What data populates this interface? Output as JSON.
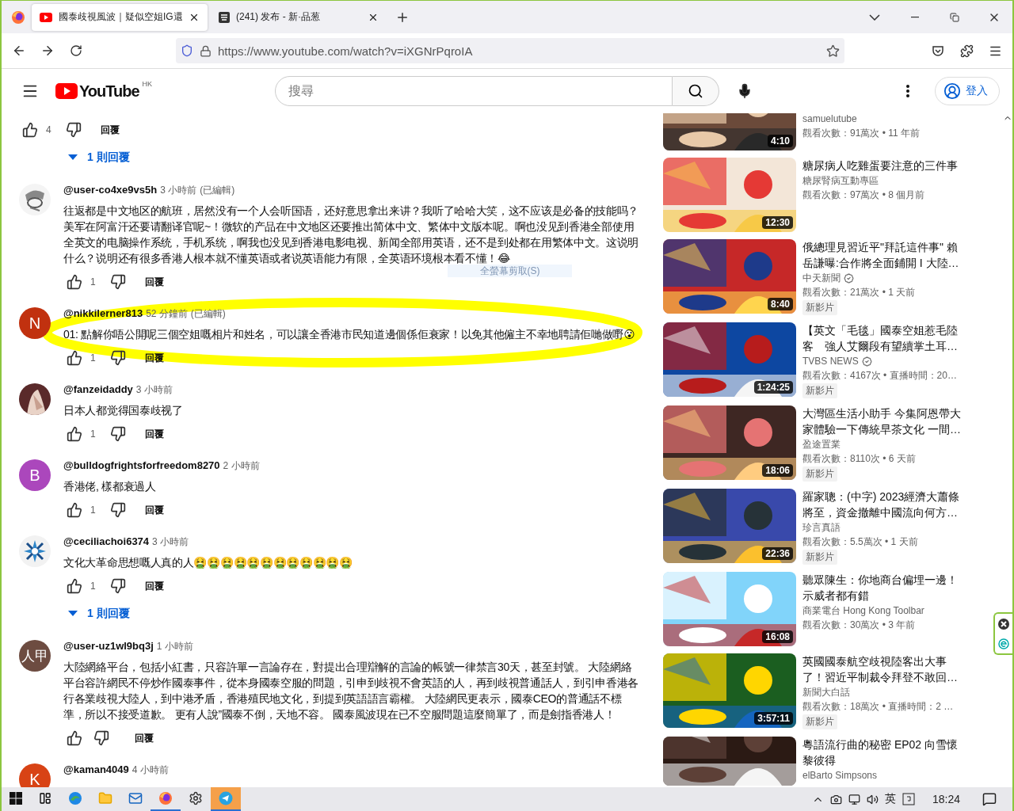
{
  "browser": {
    "tabs": [
      {
        "title": "國泰歧視風波｜疑似空姐IG還",
        "kind": "video",
        "selected": true
      },
      {
        "title": "(241) 发布 - 新·品葱",
        "kind": "forum",
        "selected": false
      }
    ],
    "url": "https://www.youtube.com/watch?v=iXGNrPqroIA"
  },
  "masthead": {
    "logo": "YouTube",
    "region": "HK",
    "search": {
      "placeholder": "搜尋"
    },
    "sign_in": "登入"
  },
  "overlay_hint": "全螢幕剪取(S)",
  "comments_top": {
    "likes": "4",
    "reply": "回覆",
    "replies": "1 則回覆"
  },
  "comments": [
    {
      "kind": "full",
      "avatar": {
        "kind": "sketch"
      },
      "author": "@user-co4xe9vs5h",
      "time": "3 小時前",
      "edited": "(已編輯)",
      "text": "往返都是中文地区的航班，居然没有一个人会听国语，还好意思拿出来讲？我听了哈哈大笑，这不应该是必备的技能吗？美军在阿富汗还要请翻译官呢~！微软的产品在中文地区还要推出简体中文、繁体中文版本呢。啊也没见到香港全部使用全英文的电脑操作系统，手机系统，啊我也没见到香港电影电视、新闻全部用英语，还不是到处都在用繁体中文。这说明什么？说明还有很多香港人根本就不懂英语或者说英语能力有限，全英语环境根本看不懂！😂",
      "likes": "1",
      "reply": "回覆",
      "highlighted": false
    },
    {
      "kind": "full",
      "avatar": {
        "kind": "letter",
        "letter": "N",
        "color": "#c1310f"
      },
      "author": "@nikkilerner813",
      "time": "52 分鐘前",
      "edited": "(已編輯)",
      "text": "01: 點解你唔公開呢三個空姐嘅相片和姓名，可以讓全香港市民知道邊個係佢衰家！以免其他僱主不幸地聘請佢哋做嘢😮",
      "likes": "1",
      "reply": "回覆",
      "highlighted": true
    },
    {
      "kind": "full",
      "author": "@fanzeidaddy",
      "time": "3 小時前",
      "text": "日本人都觉得国泰歧视了",
      "likes": "1",
      "reply": "回覆",
      "highlighted": false
    },
    {
      "kind": "full",
      "avatar": {
        "kind": "letter",
        "letter": "B",
        "color": "#ab47bc"
      },
      "author": "@bulldogfrightsforfreedom8270",
      "time": "2 小時前",
      "text": "香港佬, 樣都衰過人",
      "likes": "1",
      "reply": "回覆",
      "highlighted": false
    },
    {
      "kind": "full",
      "avatar": {
        "kind": "snowflake"
      },
      "author": "@ceciliachoi6374",
      "time": "3 小時前",
      "text": "文化大革命思想嘅人真的人🤮🤮🤮🤮🤮🤮🤮🤮🤮🤮🤮🤮",
      "likes": "1",
      "reply": "回覆",
      "replies": "1 則回覆",
      "highlighted": false
    },
    {
      "kind": "full",
      "avatar": {
        "kind": "letter",
        "letter": "人甲",
        "color": "#6d4c41"
      },
      "author": "@user-uz1wl9bq3j",
      "time": "1 小時前",
      "text": "大陸網絡平台，包括小紅書，只容許單一言論存在，對提出合理辯解的言論的帳號一律禁言30天，甚至封號。 大陸網絡平台容許網民不停炒作國泰事件，從本身國泰空服的問題，引申到歧視不會英語的人，再到歧視普通話人，到引申香港各行各業歧視大陸人，到中港矛盾，香港殖民地文化，到提到英語語言霸權。 大陸網民更表示，國泰CEO的普通話不標準，所以不接受道歉。 更有人說”國泰不倒，天地不容。 國泰風波現在已不空服問題這麼簡單了，而是劍指香港人！",
      "reply": "回覆",
      "highlighted": false
    },
    {
      "kind": "cut",
      "avatar": {
        "kind": "letter",
        "letter": "K",
        "color": "#d84315"
      },
      "author": "@kaman4049",
      "time": "4 小時前",
      "highlighted": false
    }
  ],
  "related": [
    {
      "kind": "cut",
      "channel": "samuelutube",
      "meta": "觀看次數：91萬次 • 11 年前",
      "duration": "4:10",
      "verified": false,
      "new": false
    },
    {
      "kind": "full",
      "title": "糖尿病人吃雞蛋要注意的三件事",
      "channel": "糖尿腎病互動專區",
      "meta": "觀看次數：97萬次 • 8 個月前",
      "duration": "12:30",
      "verified": false,
      "new": false
    },
    {
      "kind": "full",
      "title": "俄總理見習近平\"拜託這件事\" 賴岳謙曝:合作將全面鋪開 I 大陸…",
      "channel": "中天新聞",
      "meta": "觀看次數：21萬次 • 1 天前",
      "duration": "8:40",
      "verified": true,
      "new": true,
      "badge": "新影片"
    },
    {
      "kind": "full",
      "title": "【英文「毛毯」國泰空姐惹毛陸客　強人艾爾段有望續掌土耳…",
      "channel": "TVBS NEWS",
      "meta": "觀看次數：4167次 • 直播時間：20…",
      "duration": "1:24:25",
      "verified": true,
      "new": true,
      "badge": "新影片"
    },
    {
      "kind": "full",
      "title": "大灣區生活小助手 今集阿恩帶大家體驗一下傳統早茶文化 一間…",
      "channel": "盈途置業",
      "meta": "觀看次數：8110次 • 6 天前",
      "duration": "18:06",
      "verified": false,
      "new": true,
      "badge": "新影片"
    },
    {
      "kind": "full",
      "title": "羅家聰：(中字) 2023經濟大蕭條將至，資金撤離中國流向何方…",
      "channel": "珍言真語",
      "meta": "觀看次數：5.5萬次 • 1 天前",
      "duration": "22:36",
      "verified": false,
      "new": true,
      "badge": "新影片"
    },
    {
      "kind": "full",
      "title": "聽眾陳生：你地商台偏埋一邊！示威者都有錯",
      "channel": "商業電台 Hong Kong Toolbar",
      "meta": "觀看次數：30萬次 • 3 年前",
      "duration": "16:08",
      "verified": false,
      "new": false
    },
    {
      "kind": "full",
      "title": "英國國泰航空歧視陸客出大事了！習近平制裁令拜登不敢回…",
      "channel": "新聞大白話",
      "meta": "觀看次數：18萬次 • 直播時間：2 …",
      "duration": "3:57:11",
      "verified": false,
      "new": true,
      "badge": "新影片"
    },
    {
      "kind": "bottom",
      "title": "粵語流行曲的秘密 EP02 向雪懷黎彼得",
      "channel": "elBarto Simpsons",
      "verified": false,
      "new": false
    }
  ],
  "taskbar": {
    "apps": [
      {
        "kind": "edge",
        "running": false,
        "selected": false
      },
      {
        "kind": "folder",
        "running": false,
        "selected": false
      },
      {
        "kind": "mail",
        "running": false,
        "selected": false
      },
      {
        "kind": "firefox",
        "running": true,
        "selected": false
      },
      {
        "kind": "settings",
        "running": false,
        "selected": false
      },
      {
        "kind": "telegram",
        "running": true,
        "selected": true
      }
    ],
    "ime": "英",
    "clock": "18:24"
  }
}
